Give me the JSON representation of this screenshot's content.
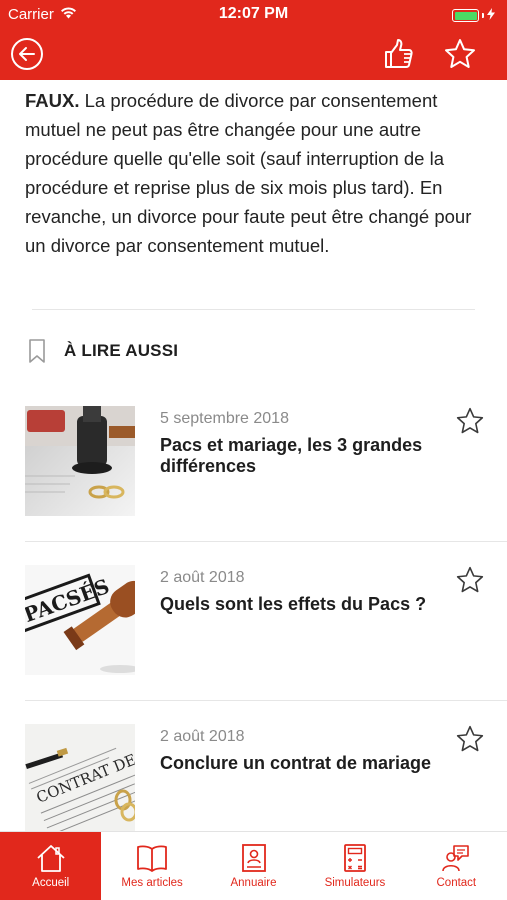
{
  "status_bar": {
    "carrier": "Carrier",
    "time": "12:07 PM",
    "battery_level": 1.0
  },
  "colors": {
    "brand_red": "#e1281c",
    "battery_green": "#4cd964",
    "date_gray": "#8a8a8a"
  },
  "nav": {
    "back_icon": "back-arrow-circle-icon",
    "like_icon": "thumbs-up-icon",
    "favorite_icon": "star-outline-icon"
  },
  "answer": {
    "lead": "FAUX.",
    "text": " La procédure de divorce par consentement mutuel ne peut pas être changée pour une autre procédure quelle qu'elle soit (sauf interruption de la procédure et reprise plus de six mois plus tard). En revanche, un divorce pour faute peut être changé pour un divorce par consentement mutuel."
  },
  "also_read": {
    "title": "À LIRE AUSSI",
    "icon": "bookmark-outline-icon"
  },
  "articles": [
    {
      "date": "5 septembre 2018",
      "title": "Pacs et mariage, les 3 grandes différences",
      "image": "gavel-and-rings"
    },
    {
      "date": "2 août 2018",
      "title": "Quels sont les effets du Pacs ?",
      "image": "pacses-stamp"
    },
    {
      "date": "2 août 2018",
      "title": "Conclure un contrat de mariage",
      "image": "marriage-contract-document"
    }
  ],
  "tabs": [
    {
      "label": "Accueil",
      "icon": "home-icon",
      "active": true
    },
    {
      "label": "Mes articles",
      "icon": "open-book-icon",
      "active": false
    },
    {
      "label": "Annuaire",
      "icon": "directory-card-icon",
      "active": false
    },
    {
      "label": "Simulateurs",
      "icon": "calculator-icon",
      "active": false
    },
    {
      "label": "Contact",
      "icon": "chat-person-icon",
      "active": false
    }
  ]
}
